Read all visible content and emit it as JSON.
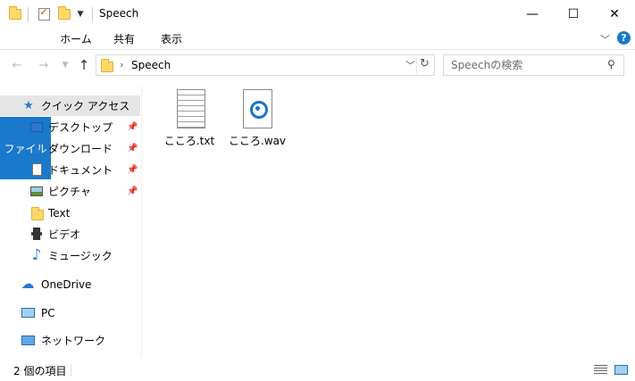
{
  "window": {
    "title": "Speech",
    "minimize": "—",
    "maximize": "☐",
    "close": "✕"
  },
  "ribbon": {
    "tabs": [
      {
        "label": "ファイル"
      },
      {
        "label": "ホーム"
      },
      {
        "label": "共有"
      },
      {
        "label": "表示"
      }
    ],
    "help": "?"
  },
  "address": {
    "path": "Speech",
    "search_placeholder": "Speechの検索"
  },
  "nav": {
    "items": [
      {
        "label": "クイック アクセス"
      },
      {
        "label": "デスクトップ"
      },
      {
        "label": "ダウンロード"
      },
      {
        "label": "ドキュメント"
      },
      {
        "label": "ピクチャ"
      },
      {
        "label": "Text"
      },
      {
        "label": "ビデオ"
      },
      {
        "label": "ミュージック"
      },
      {
        "label": "OneDrive"
      },
      {
        "label": "PC"
      },
      {
        "label": "ネットワーク"
      }
    ]
  },
  "files": [
    {
      "name": "こころ.txt",
      "icon": "text-file-icon"
    },
    {
      "name": "こころ.wav",
      "icon": "audio-file-icon"
    }
  ],
  "status": {
    "count": "2 個の項目"
  }
}
